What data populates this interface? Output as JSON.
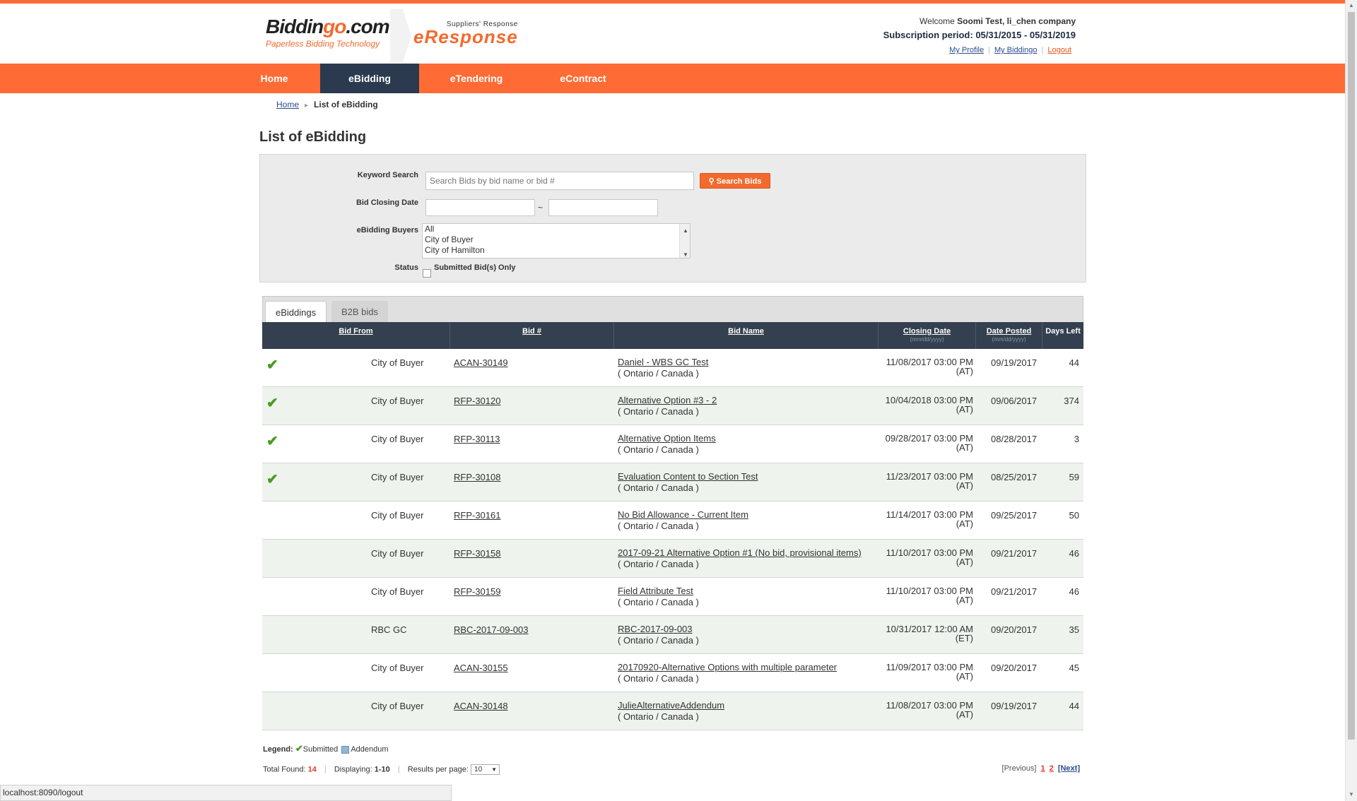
{
  "brand": {
    "logo_main_a": "Biddin",
    "logo_main_b": "go",
    "logo_main_c": ".com",
    "logo_tagline": "Paperless Bidding Technology",
    "product_small": "Suppliers' Response",
    "product_name": "eResponse",
    "accent_color": "#ff6b35",
    "nav_active_color": "#2b3a4f"
  },
  "user": {
    "welcome_prefix": "Welcome",
    "name": "Soomi Test, li_chen company",
    "subscription": "Subscription period: 05/31/2015 - 05/31/2019",
    "links": {
      "profile": "My Profile",
      "biddingo": "My Biddingo",
      "logout": "Logout"
    }
  },
  "nav": {
    "items": [
      {
        "label": "Home"
      },
      {
        "label": "eBidding",
        "active": true
      },
      {
        "label": "eTendering"
      },
      {
        "label": "eContract"
      }
    ]
  },
  "breadcrumb": {
    "home": "Home",
    "current": "List of eBidding"
  },
  "page_title": "List of eBidding",
  "search": {
    "keyword_label": "Keyword Search",
    "keyword_placeholder": "Search Bids by bid name or bid #",
    "keyword_value": "",
    "button_label": "Search Bids",
    "closing_label": "Bid Closing Date",
    "closing_from": "",
    "closing_to": "",
    "closing_sep": "~",
    "buyers_label": "eBidding Buyers",
    "buyers_options": [
      "All",
      "City of Buyer",
      "City of Hamilton"
    ],
    "status_label": "Status",
    "status_option": "Submitted Bid(s) Only"
  },
  "tabs": [
    {
      "label": "eBiddings",
      "active": true
    },
    {
      "label": "B2B bids"
    }
  ],
  "table": {
    "headers": {
      "from": "Bid From",
      "bid": "Bid #",
      "name": "Bid Name",
      "closing": "Closing Date",
      "closing_sub": "(mm/dd/yyyy)",
      "posted": "Date Posted",
      "posted_sub": "(mm/dd/yyyy)",
      "days": "Days Left"
    },
    "rows": [
      {
        "submitted": true,
        "from": "City of Buyer",
        "bid": "ACAN-30149",
        "name": "Daniel - WBS GC Test",
        "location": "( Ontario / Canada )",
        "closing": "11/08/2017 03:00 PM",
        "tz": "(AT)",
        "posted": "09/19/2017",
        "days": "44"
      },
      {
        "submitted": true,
        "from": "City of Buyer",
        "bid": "RFP-30120",
        "name": "Alternative Option #3 - 2",
        "location": "( Ontario / Canada )",
        "closing": "10/04/2018 03:00 PM",
        "tz": "(AT)",
        "posted": "09/06/2017",
        "days": "374"
      },
      {
        "submitted": true,
        "from": "City of Buyer",
        "bid": "RFP-30113",
        "name": "Alternative Option Items",
        "location": "( Ontario / Canada )",
        "closing": "09/28/2017 03:00 PM",
        "tz": "(AT)",
        "posted": "08/28/2017",
        "days": "3"
      },
      {
        "submitted": true,
        "from": "City of Buyer",
        "bid": "RFP-30108",
        "name": "Evaluation Content to Section Test",
        "location": "( Ontario / Canada )",
        "closing": "11/23/2017 03:00 PM",
        "tz": "(AT)",
        "posted": "08/25/2017",
        "days": "59"
      },
      {
        "submitted": false,
        "from": "City of Buyer",
        "bid": "RFP-30161",
        "name": "No Bid Allowance - Current Item",
        "location": "( Ontario / Canada )",
        "closing": "11/14/2017 03:00 PM",
        "tz": "(AT)",
        "posted": "09/25/2017",
        "days": "50"
      },
      {
        "submitted": false,
        "from": "City of Buyer",
        "bid": "RFP-30158",
        "name": "2017-09-21 Alternative Option #1 (No bid, provisional items)",
        "location": "( Ontario / Canada )",
        "closing": "11/10/2017 03:00 PM",
        "tz": "(AT)",
        "posted": "09/21/2017",
        "days": "46"
      },
      {
        "submitted": false,
        "from": "City of Buyer",
        "bid": "RFP-30159",
        "name": "Field Attribute Test",
        "location": "( Ontario / Canada )",
        "closing": "11/10/2017 03:00 PM",
        "tz": "(AT)",
        "posted": "09/21/2017",
        "days": "46"
      },
      {
        "submitted": false,
        "from": "RBC GC",
        "bid": "RBC-2017-09-003",
        "name": "RBC-2017-09-003",
        "location": "( Ontario / Canada )",
        "closing": "10/31/2017 12:00 AM",
        "tz": "(ET)",
        "posted": "09/20/2017",
        "days": "35"
      },
      {
        "submitted": false,
        "from": "City of Buyer",
        "bid": "ACAN-30155",
        "name": "20170920-Alternative Options with multiple parameter",
        "location": "( Ontario / Canada )",
        "closing": "11/09/2017 03:00 PM",
        "tz": "(AT)",
        "posted": "09/20/2017",
        "days": "45"
      },
      {
        "submitted": false,
        "from": "City of Buyer",
        "bid": "ACAN-30148",
        "name": "JulieAlternativeAddendum",
        "location": "( Ontario / Canada )",
        "closing": "11/08/2017 03:00 PM",
        "tz": "(AT)",
        "posted": "09/19/2017",
        "days": "44"
      }
    ]
  },
  "legend": {
    "label": "Legend:",
    "submitted": "Submitted",
    "addendum": "Addendum"
  },
  "footer": {
    "total_label": "Total Found:",
    "total": "14",
    "displaying_label": "Displaying:",
    "displaying": "1-10",
    "per_page_label": "Results per page:",
    "per_page": "10"
  },
  "pager": {
    "prev": "[Previous]",
    "pages": [
      "1",
      "2"
    ],
    "next": "[Next]"
  },
  "status_bar": "localhost:8090/logout"
}
